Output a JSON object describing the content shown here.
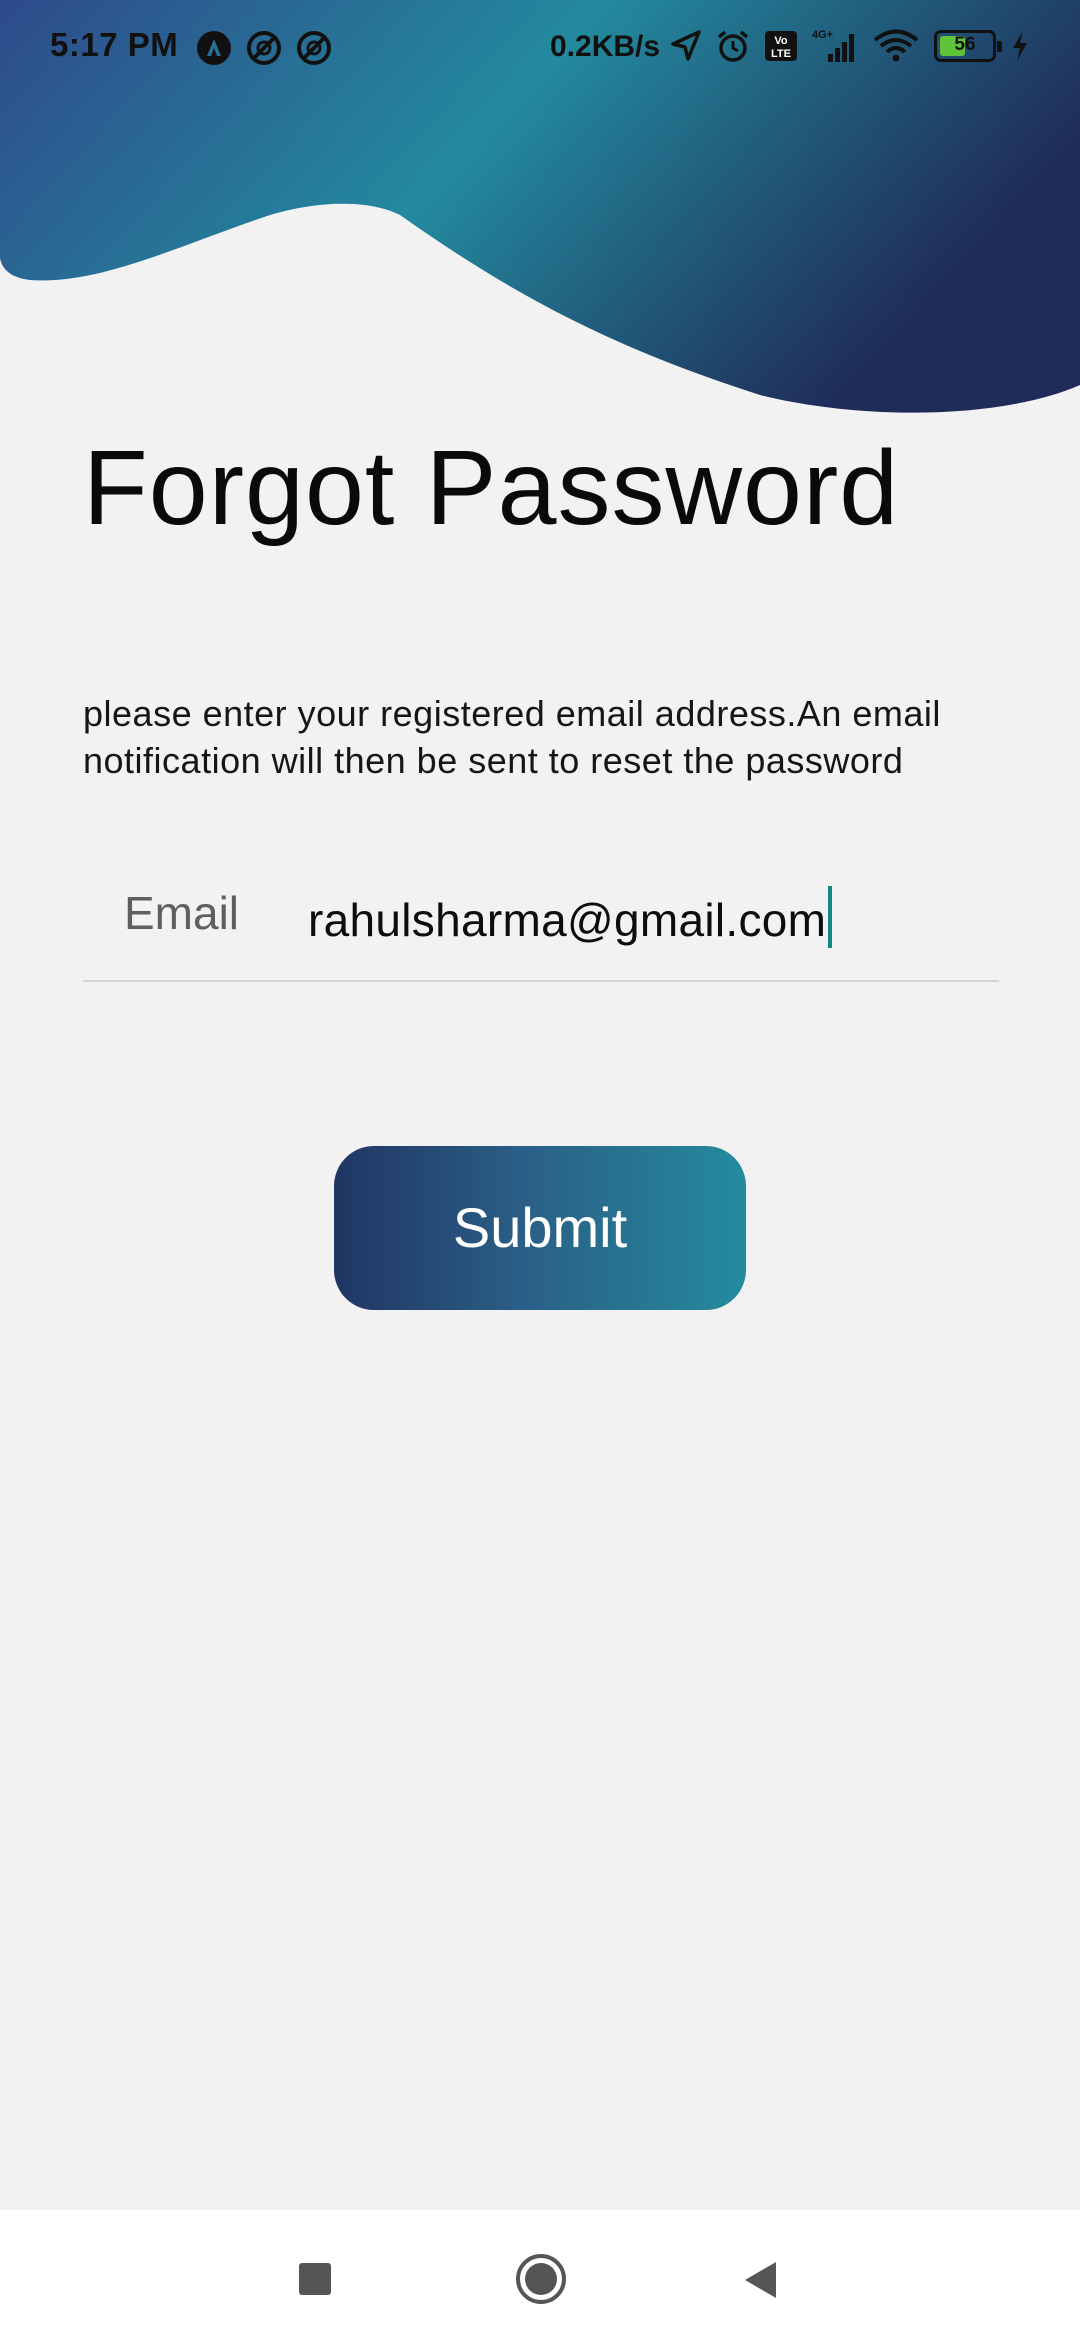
{
  "status_bar": {
    "time": "5:17 PM",
    "left_icons": [
      "app-notification-icon",
      "sync-icon",
      "sync-icon"
    ],
    "net_speed": "0.2KB/s",
    "right_icons": [
      "location-arrow-icon",
      "alarm-icon",
      "volte-icon",
      "signal-icon",
      "wifi-icon",
      "battery-icon",
      "charging-icon"
    ],
    "volte_text": "Vo LTE",
    "network_text": "4G+",
    "battery_level": "56",
    "battery_fraction": 0.56
  },
  "header": {
    "gradient_colors": [
      "#2d4f8c",
      "#238a9e",
      "#1f2d58"
    ]
  },
  "form": {
    "title": "Forgot Password",
    "description": "please enter your registered email address.An email notification will then be sent to reset the password",
    "email_label": "Email",
    "email_value": "rahulsharma@gmail.com",
    "submit_label": "Submit"
  },
  "nav_bar": {
    "buttons": [
      "recents-square-icon",
      "home-circle-icon",
      "back-triangle-icon"
    ]
  }
}
